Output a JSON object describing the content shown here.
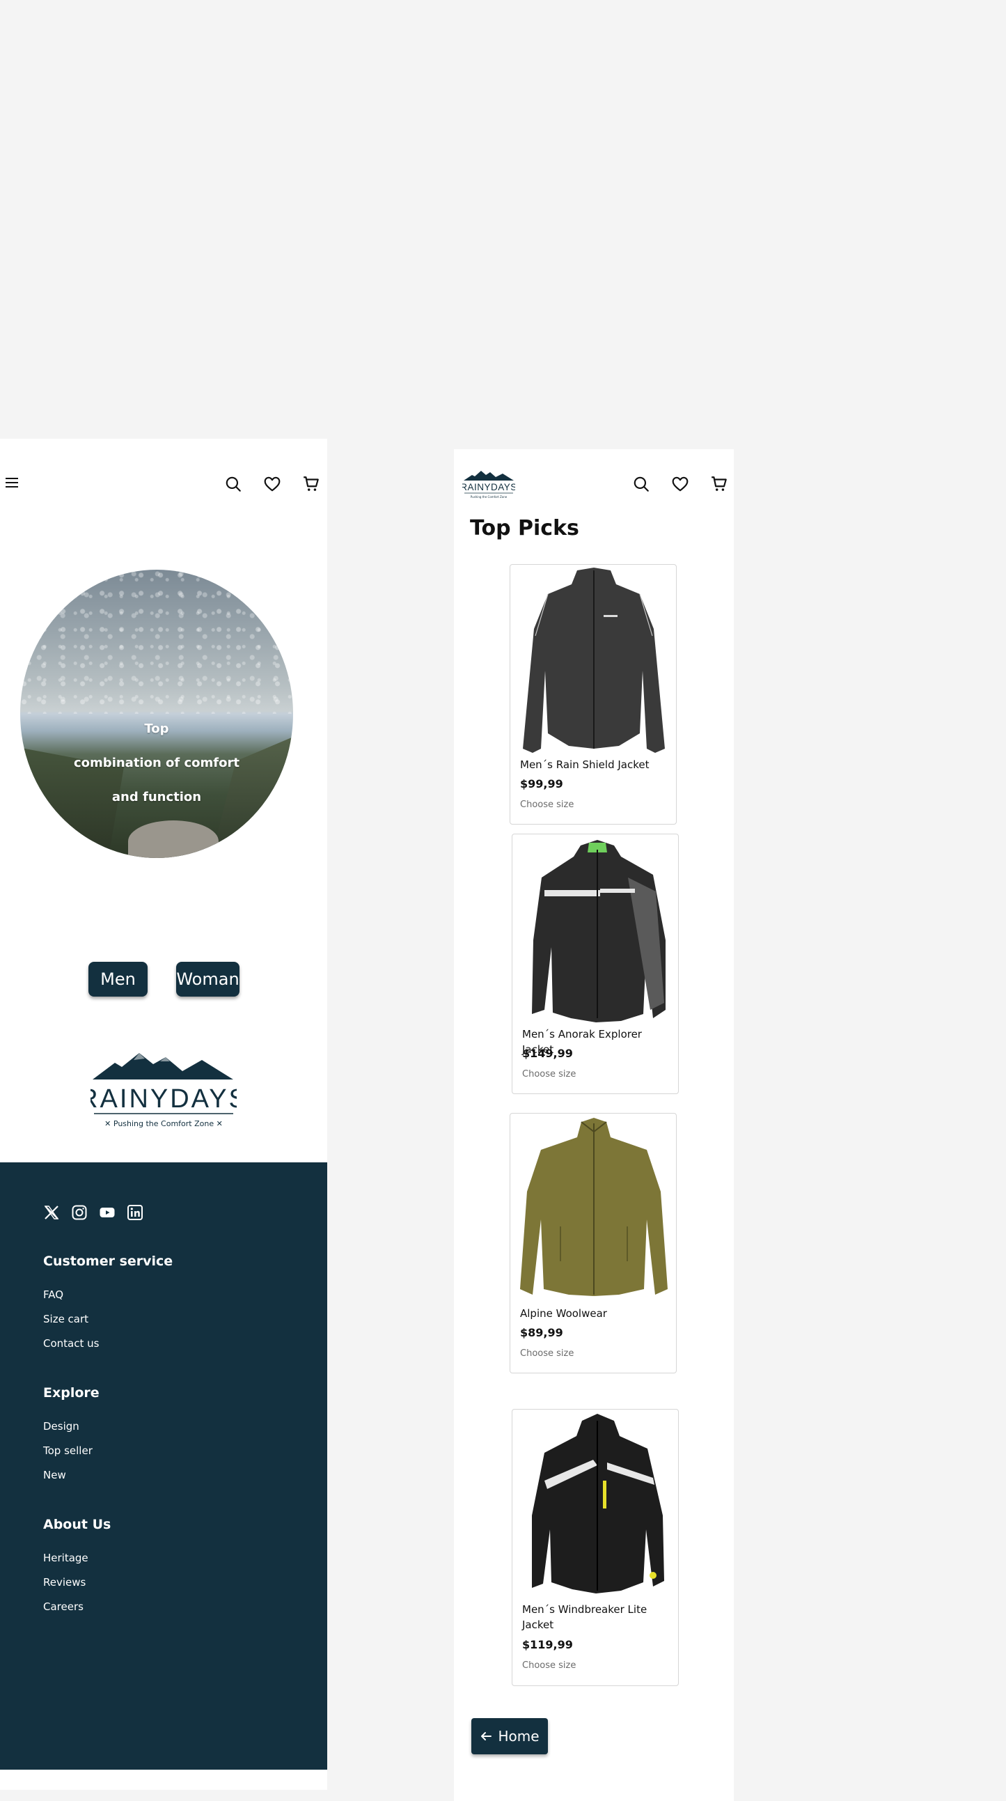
{
  "brand": {
    "name": "RAINYDAYS",
    "tagline": "Pushing the Comfort Zone",
    "primary_color": "#13303f"
  },
  "header_icons": [
    "menu-icon",
    "search-icon",
    "heart-icon",
    "cart-icon"
  ],
  "home": {
    "hero": {
      "line1": "Top",
      "line2": "combination of comfort",
      "line3": "and function"
    },
    "categories": {
      "men": "Men",
      "woman": "Woman"
    }
  },
  "footer": {
    "socials": [
      "x-icon",
      "instagram-icon",
      "youtube-icon",
      "linkedin-icon"
    ],
    "sections": [
      {
        "title": "Customer service",
        "links": [
          "FAQ",
          "Size cart",
          "Contact us"
        ]
      },
      {
        "title": "Explore",
        "links": [
          "Design",
          "Top seller",
          "New"
        ]
      },
      {
        "title": "About Us",
        "links": [
          "Heritage",
          "Reviews",
          "Careers"
        ]
      }
    ]
  },
  "top_picks": {
    "title": "Top Picks",
    "products": [
      {
        "name": "Men´s Rain Shield Jacket",
        "price": "$99,99",
        "size_label": "Choose size",
        "color": "#3a3a3a"
      },
      {
        "name": "Men´s Anorak Explorer Jacket",
        "price": "$149,99",
        "size_label": "Choose size",
        "color": "#2b2b2b"
      },
      {
        "name": "Alpine Woolwear",
        "price": "$89,99",
        "size_label": "Choose size",
        "color": "#7d7637"
      },
      {
        "name": "Men´s Windbreaker Lite Jacket",
        "price": "$119,99",
        "size_label": "Choose size",
        "color": "#1d1d1d"
      }
    ],
    "home_button": "Home"
  }
}
